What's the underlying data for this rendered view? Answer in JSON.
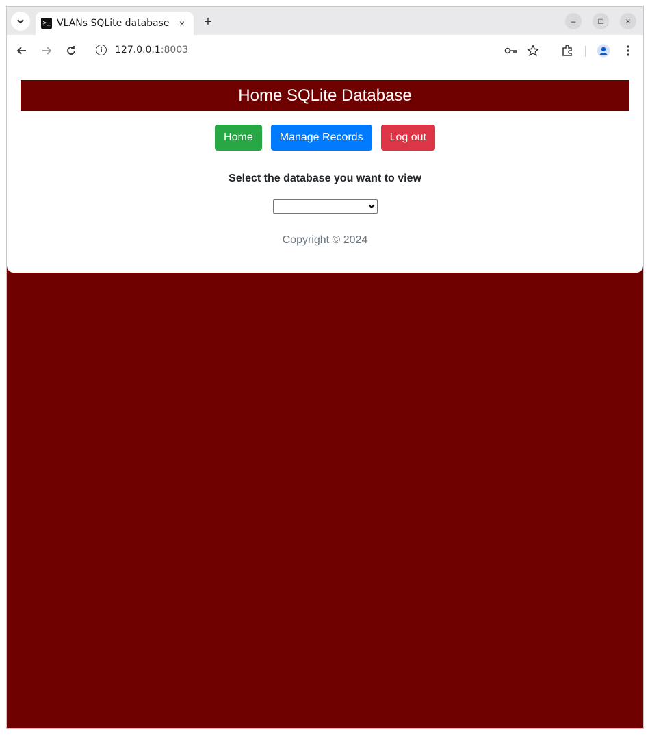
{
  "browser": {
    "tab_title": "VLANs SQLite database",
    "tab_favicon": ">_",
    "tab_close": "×",
    "new_tab": "+",
    "url_host": "127.0.0.1",
    "url_port": ":8003",
    "controls": {
      "minimize": "–",
      "maximize": "□",
      "close": "×"
    }
  },
  "page": {
    "header_title": "Home SQLite Database",
    "nav": {
      "home_label": "Home",
      "manage_label": "Manage Records",
      "logout_label": "Log out"
    },
    "select_prompt": "Select the database you want to view",
    "select_value": "",
    "copyright": "Copyright © 2024"
  },
  "colors": {
    "page_background": "#6e0000",
    "header_background": "#6e0000",
    "home_button": "#28a745",
    "manage_button": "#007bff",
    "logout_button": "#dc3545"
  },
  "icons": [
    "tab-search-icon",
    "terminal-icon",
    "back-icon",
    "forward-icon",
    "reload-icon",
    "info-icon",
    "password-key-icon",
    "bookmark-star-icon",
    "extensions-icon",
    "profile-icon",
    "menu-icon"
  ]
}
